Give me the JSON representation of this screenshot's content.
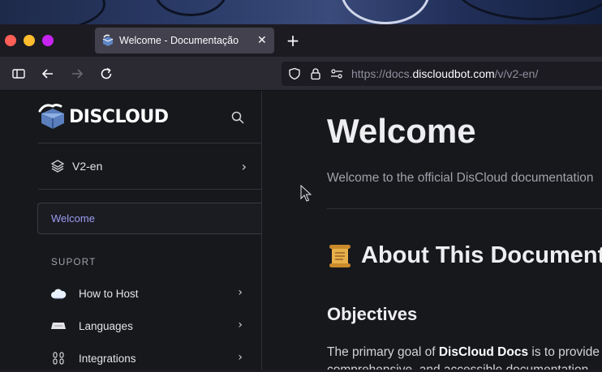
{
  "browser": {
    "window_controls": [
      "close",
      "minimize",
      "maximize"
    ],
    "colors": {
      "close": "#ff5f57",
      "minimize": "#febc2e",
      "maximize": "#c724f0"
    },
    "tab": {
      "title": "Welcome - Documentação",
      "close_icon": "close-icon"
    },
    "new_tab_icon": "+",
    "url": {
      "scheme": "https://",
      "host_prefix": "docs.",
      "host": "discloudbot.com",
      "path": "/v/v2-en/"
    }
  },
  "sidebar": {
    "logo_text": "DISCLOUD",
    "version": {
      "label": "V2-en"
    },
    "active_item": "Welcome",
    "section_title": "SUPORT",
    "items": [
      {
        "label": "How to Host",
        "icon": "cloud-icon"
      },
      {
        "label": "Languages",
        "icon": "keyboard-icon"
      },
      {
        "label": "Integrations",
        "icon": "links-icon"
      }
    ]
  },
  "main": {
    "title": "Welcome",
    "lead": "Welcome to the official DisCloud documentation",
    "about_heading": "About This Documentation",
    "objectives_heading": "Objectives",
    "paragraph_prefix": "The primary goal of ",
    "paragraph_bold": "DisCloud Docs",
    "paragraph_suffix": " is to provide",
    "paragraph_line2": "comprehensive, and accessible documentation"
  }
}
